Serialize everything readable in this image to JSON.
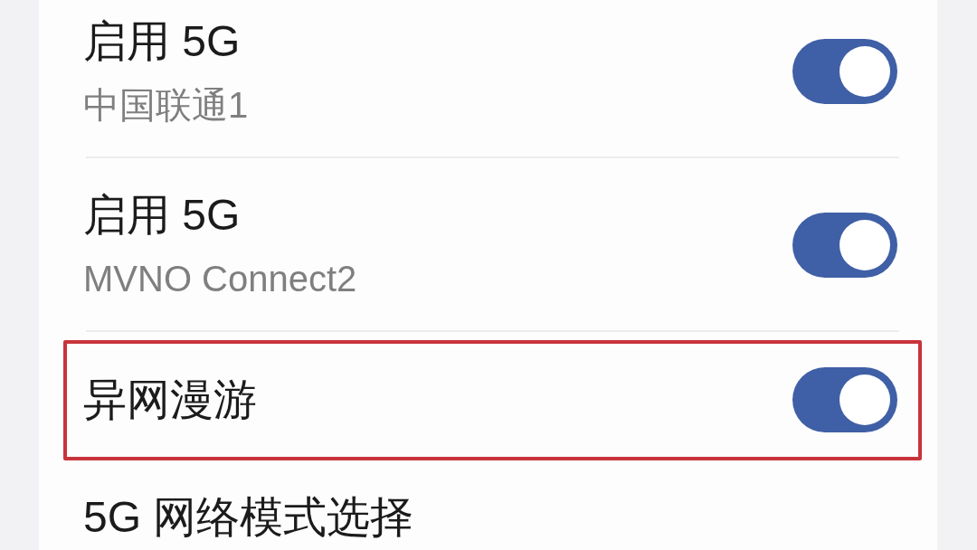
{
  "settings": {
    "rows": [
      {
        "kind": "switch",
        "title": "启用 5G",
        "subtitle": "中国联通1",
        "on": true,
        "highlighted": false
      },
      {
        "kind": "switch",
        "title": "启用 5G",
        "subtitle": "MVNO Connect2",
        "on": true,
        "highlighted": false
      },
      {
        "kind": "switch",
        "title": "异网漫游",
        "on": true,
        "highlighted": true
      },
      {
        "kind": "item",
        "title": "5G 网络模式选择",
        "highlighted": false
      }
    ]
  }
}
